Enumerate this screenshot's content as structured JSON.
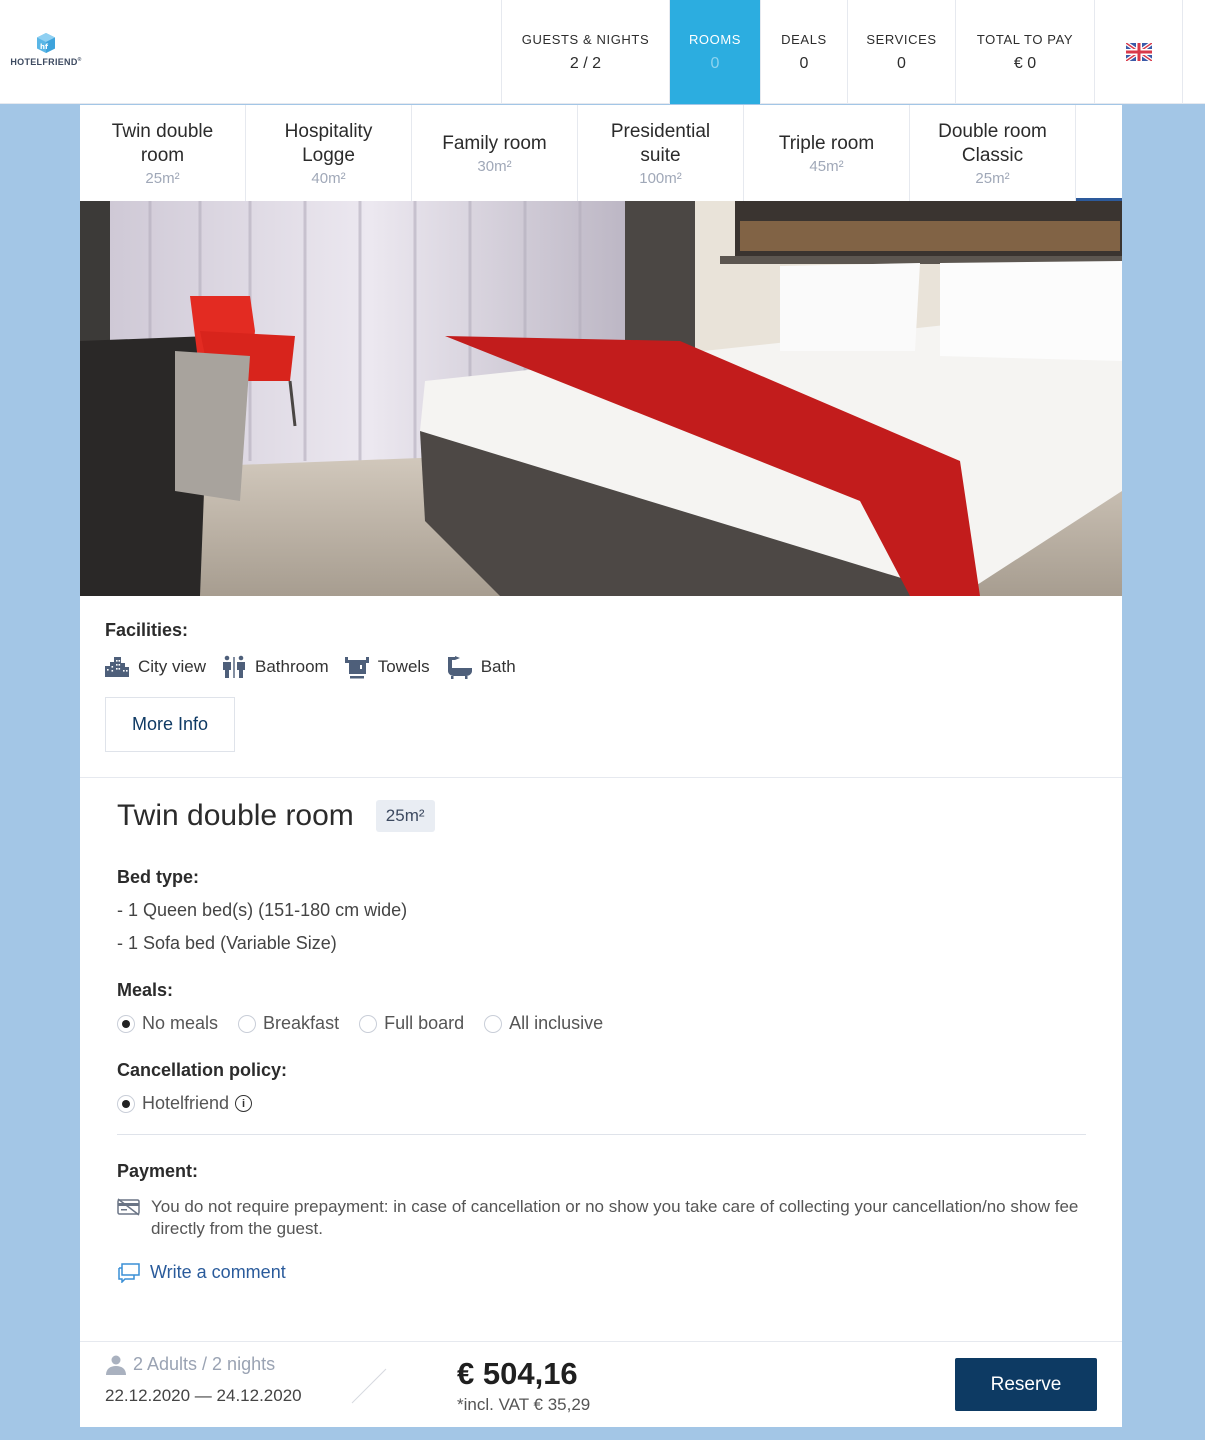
{
  "brand": {
    "name": "HOTELFRIEND",
    "trademark": "®"
  },
  "nav": [
    {
      "label": "GUESTS & NIGHTS",
      "value": "2 / 2",
      "active": false
    },
    {
      "label": "ROOMS",
      "value": "0",
      "active": true
    },
    {
      "label": "DEALS",
      "value": "0",
      "active": false
    },
    {
      "label": "SERVICES",
      "value": "0",
      "active": false
    },
    {
      "label": "TOTAL TO PAY",
      "value": "€ 0",
      "active": false
    }
  ],
  "language_flag": "uk-flag-icon",
  "accent_color": "#2cade0",
  "room_tabs": [
    {
      "name": "Twin double room",
      "size": "25m²"
    },
    {
      "name": "Hospitality Logge",
      "size": "40m²"
    },
    {
      "name": "Family room",
      "size": "30m²"
    },
    {
      "name": "Presidential suite",
      "size": "100m²"
    },
    {
      "name": "Triple room",
      "size": "45m²"
    },
    {
      "name": "Double room Classic",
      "size": "25m²"
    }
  ],
  "facilities": {
    "title": "Facilities:",
    "items": [
      {
        "icon": "city-view-icon",
        "label": "City view"
      },
      {
        "icon": "bathroom-icon",
        "label": "Bathroom"
      },
      {
        "icon": "towels-icon",
        "label": "Towels"
      },
      {
        "icon": "bath-icon",
        "label": "Bath"
      }
    ],
    "more_info": "More Info"
  },
  "room": {
    "title": "Twin double room",
    "size_badge": "25m²",
    "bed_type_title": "Bed type:",
    "beds": [
      "- 1 Queen bed(s) (151-180 cm wide)",
      "- 1 Sofa bed (Variable Size)"
    ],
    "meals_title": "Meals:",
    "meals": [
      {
        "label": "No meals",
        "selected": true
      },
      {
        "label": "Breakfast",
        "selected": false
      },
      {
        "label": "Full board",
        "selected": false
      },
      {
        "label": "All inclusive",
        "selected": false
      }
    ],
    "cancellation_title": "Cancellation policy:",
    "cancellation": {
      "label": "Hotelfriend",
      "selected": true
    },
    "payment_title": "Payment:",
    "payment_text": "You do not require prepayment: in case of cancellation or no show you take care of collecting your cancellation/no show fee directly from the guest.",
    "comment_link": "Write a comment"
  },
  "footer": {
    "guests": "2 Adults / 2 nights",
    "dates": "22.12.2020 — 24.12.2020",
    "price": "€ 504,16",
    "vat": "*incl. VAT € 35,29",
    "reserve": "Reserve"
  }
}
